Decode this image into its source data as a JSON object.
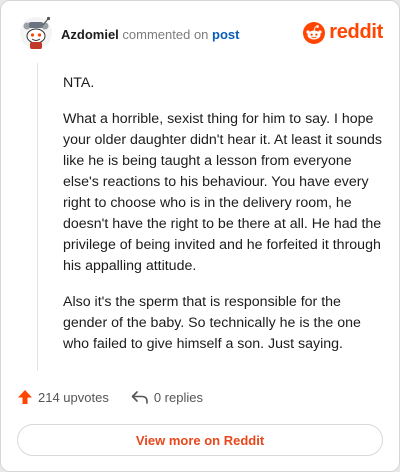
{
  "comment": {
    "author": "Azdomiel",
    "action": "commented on",
    "target": "post",
    "brand": "reddit",
    "paragraphs": [
      "NTA.",
      "What a horrible, sexist thing for him to say. I hope your older daughter didn't hear it. At least it sounds like he is being taught a lesson from everyone else's reactions to his behaviour. You have every right to choose who is in the delivery room, he doesn't have the right to be there at all. He had the privilege of being invited and he forfeited it through his appalling attitude.",
      "Also it's the sperm that is responsible for the gender of the baby. So technically he is the one who failed to give himself a son. Just saying."
    ]
  },
  "footer": {
    "upvotes": "214 upvotes",
    "replies": "0 replies",
    "view_more": "View more on Reddit"
  },
  "icons": {
    "avatar": "snoo-avatar-icon",
    "brand": "reddit-logo-icon",
    "upvote": "upvote-arrow-icon",
    "reply": "reply-arrow-icon"
  },
  "colors": {
    "brand": "#ff4500",
    "link": "#0b5db9",
    "upvote": "#ff4500"
  }
}
